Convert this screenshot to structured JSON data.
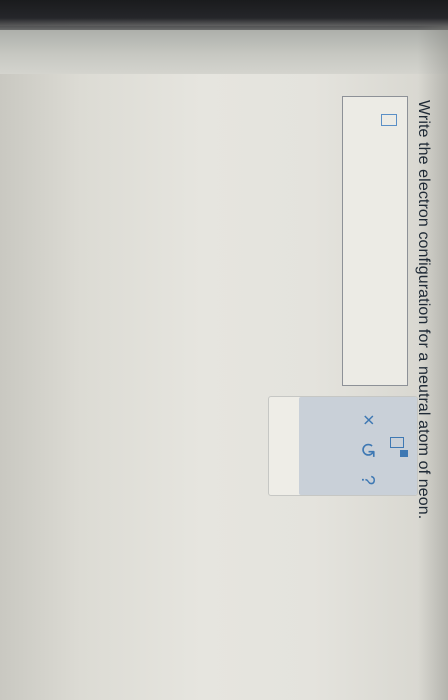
{
  "question": {
    "text": "Write the electron configuration for a neutral atom of neon."
  },
  "answer": {
    "value": ""
  },
  "toolbar": {
    "superscript_icon": "superscript-template-icon",
    "clear_glyph": "×",
    "undo_glyph": "↺",
    "help_glyph": "?"
  },
  "colors": {
    "accent": "#3e78b3",
    "text": "#1f2a36",
    "toolbar_bg": "#c9d0d8"
  }
}
